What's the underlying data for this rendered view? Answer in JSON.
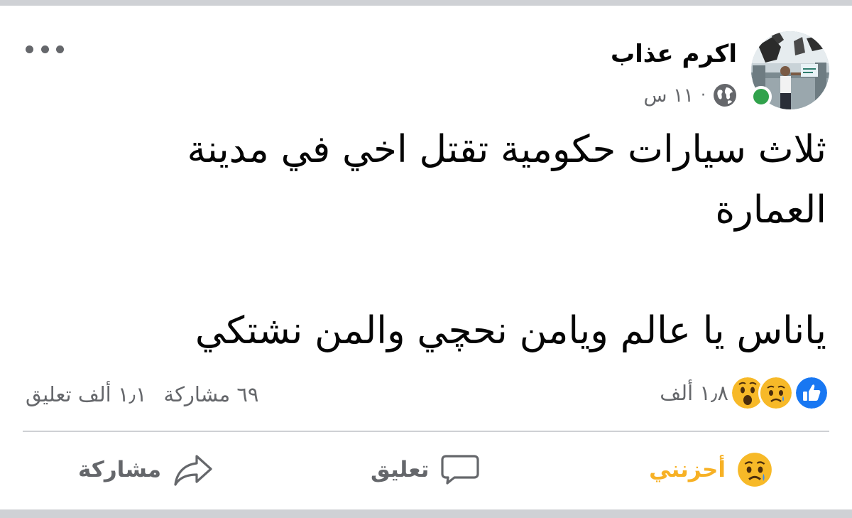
{
  "post": {
    "author": "اكرم عذاب",
    "time": "١١ س",
    "separator": "·",
    "privacy_icon": "globe-icon",
    "status_indicator": "online",
    "text_lines": [
      "ثلاث سيارات حكومية تقتل اخي في مدينة",
      "العمارة",
      "ياناس يا عالم ويامن نحچي والمن نشتكي"
    ]
  },
  "stats": {
    "reaction_icons": [
      "like-icon",
      "sad-icon",
      "wow-icon"
    ],
    "reactions_count": "١٫٨ ألف",
    "comments": "١٫١ ألف تعليق",
    "shares": "٦٩ مشاركة"
  },
  "actions": {
    "react_label": "أحزنني",
    "comment_label": "تعليق",
    "share_label": "مشاركة"
  },
  "colors": {
    "online": "#31a24c",
    "reacted": "#f7b125",
    "like_blue": "#1877f2",
    "muted_text": "#65676b"
  }
}
